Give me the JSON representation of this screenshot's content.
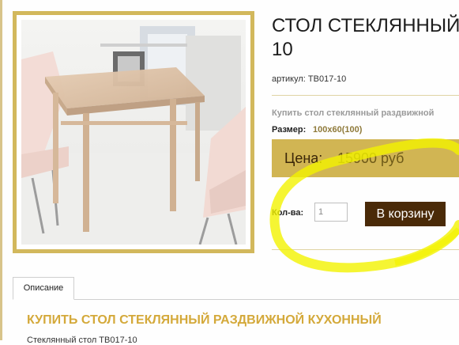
{
  "product": {
    "title_line1": "СТОЛ СТЕКЛЯННЫЙ",
    "title_line2": "10",
    "sku_label": "артикул:",
    "sku_value": "TB017-10",
    "description": "Купить стол стеклянный раздвижной",
    "size_label": "Размер:",
    "size_value": "100x60(100)",
    "price_label": "Цена:",
    "price_value": "15900 руб",
    "qty_label": "Кол-ва:",
    "qty_value": "1",
    "cart_button": "В корзину"
  },
  "tabs": [
    {
      "label": "Описание"
    }
  ],
  "section": {
    "heading": "КУПИТЬ СТОЛ СТЕКЛЯННЫЙ РАЗДВИЖНОЙ КУХОННЫЙ",
    "body_fragment": "Стеклянный стол TB017-10"
  },
  "colors": {
    "accent_gold": "#d1b553",
    "button_brown": "#4a2a08",
    "heading_gold": "#d4a93a",
    "highlight_yellow": "#f3f200"
  }
}
